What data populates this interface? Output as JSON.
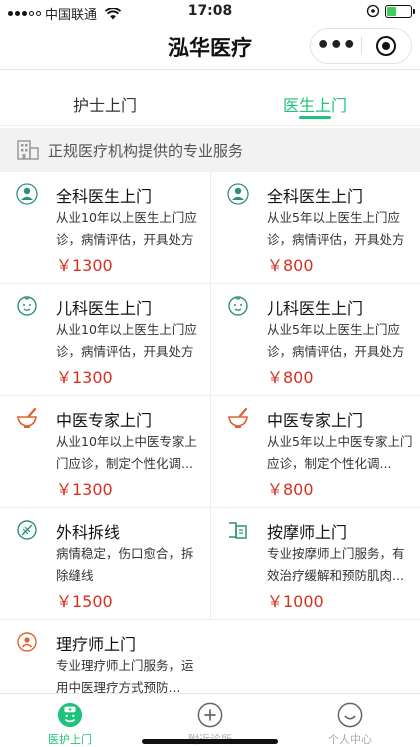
{
  "status_bar": {
    "carrier": "中国联通",
    "time": "17:08"
  },
  "nav": {
    "title": "泓华医疗"
  },
  "tabs": [
    {
      "label": "护士上门",
      "active": false
    },
    {
      "label": "医生上门",
      "active": true
    }
  ],
  "section_header": {
    "text": "正规医疗机构提供的专业服务"
  },
  "services": [
    {
      "icon": "doctor-icon",
      "title": "全科医生上门",
      "desc": "从业10年以上医生上门应诊，病情评估，开具处方",
      "price": "￥1300"
    },
    {
      "icon": "doctor-icon",
      "title": "全科医生上门",
      "desc": "从业5年以上医生上门应诊，病情评估，开具处方",
      "price": "￥800"
    },
    {
      "icon": "child-face-icon",
      "title": "儿科医生上门",
      "desc": "从业10年以上医生上门应诊，病情评估，开具处方",
      "price": "￥1300"
    },
    {
      "icon": "child-face-icon",
      "title": "儿科医生上门",
      "desc": "从业5年以上医生上门应诊，病情评估，开具处方",
      "price": "￥800"
    },
    {
      "icon": "mortar-pestle-icon",
      "title": "中医专家上门",
      "desc": "从业10年以上中医专家上门应诊，制定个性化调...",
      "price": "￥1300"
    },
    {
      "icon": "mortar-pestle-icon",
      "title": "中医专家上门",
      "desc": "从业5年以上中医专家上门应诊，制定个性化调...",
      "price": "￥800"
    },
    {
      "icon": "suture-icon",
      "title": "外科拆线",
      "desc": "病情稳定，伤口愈合，拆除缝线",
      "price": "￥1500"
    },
    {
      "icon": "massage-bed-icon",
      "title": "按摩师上门",
      "desc": "专业按摩师上门服务，有效治疗缓解和预防肌肉...",
      "price": "￥1000"
    },
    {
      "icon": "therapist-icon",
      "title": "理疗师上门",
      "desc": "专业理疗师上门服务，运用中医理疗方式预防...",
      "price": ""
    }
  ],
  "tab_bar": [
    {
      "label": "医护上门",
      "icon": "nurse-icon",
      "active": true
    },
    {
      "label": "附近诊所",
      "icon": "plus-circle-icon",
      "active": false
    },
    {
      "label": "个人中心",
      "icon": "smile-face-icon",
      "active": false
    }
  ],
  "colors": {
    "accent": "#1ec27a",
    "price": "#d6311f",
    "icon_teal": "#2f8f7a",
    "icon_orange": "#e0622c"
  }
}
